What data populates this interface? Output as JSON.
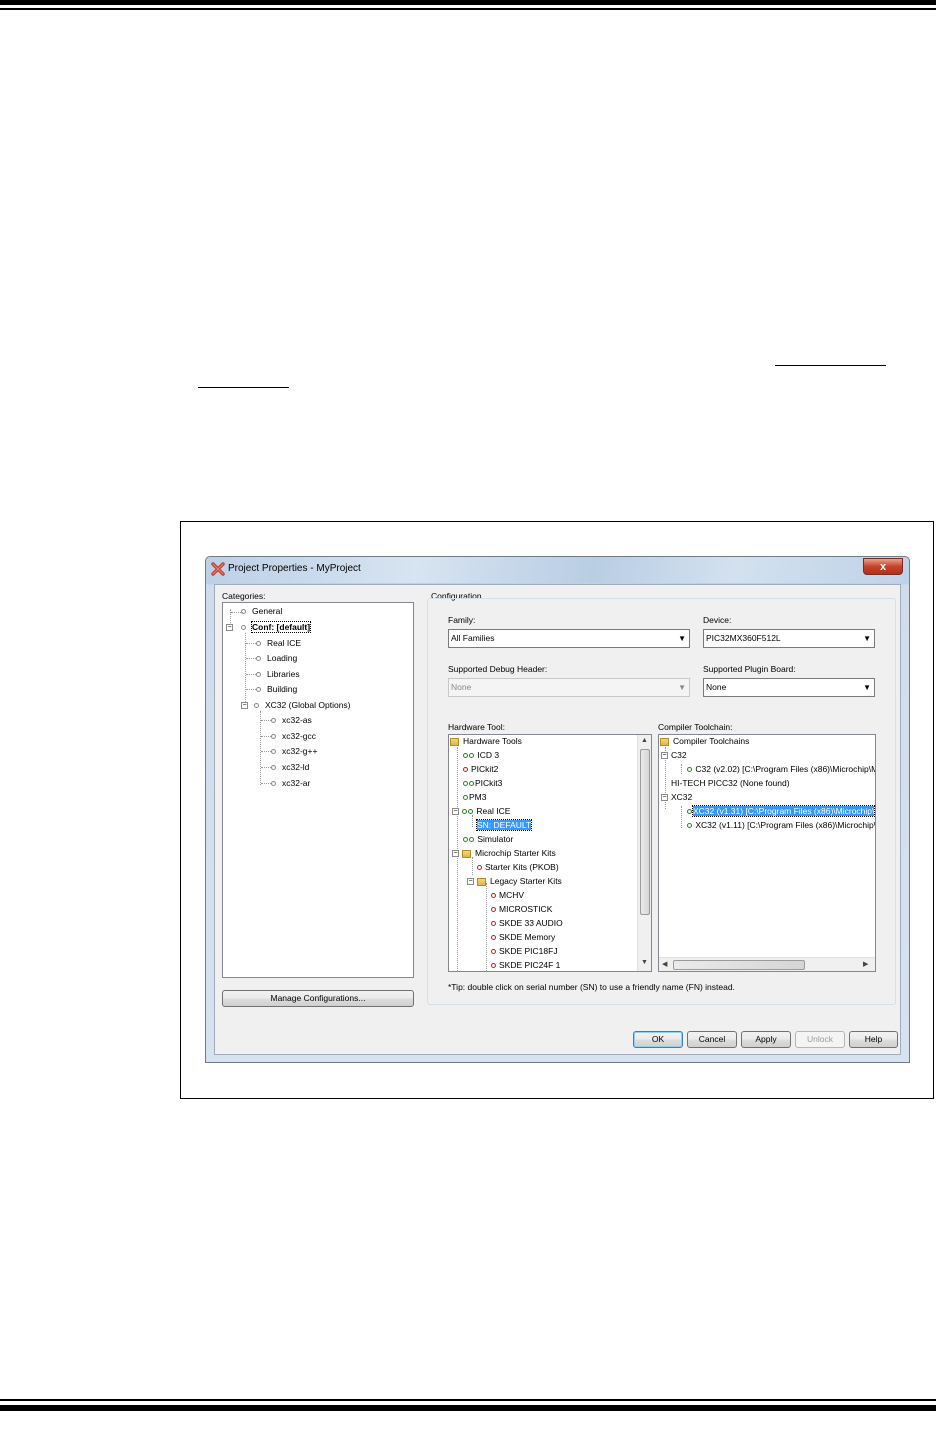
{
  "window": {
    "title": "Project Properties - MyProject",
    "close_label": "x"
  },
  "categories": {
    "label": "Categories:",
    "items": [
      {
        "label": "General"
      },
      {
        "label": "Conf: [default]"
      },
      {
        "label": "Real ICE"
      },
      {
        "label": "Loading"
      },
      {
        "label": "Libraries"
      },
      {
        "label": "Building"
      },
      {
        "label": "XC32 (Global Options)"
      },
      {
        "label": "xc32-as"
      },
      {
        "label": "xc32-gcc"
      },
      {
        "label": "xc32-g++"
      },
      {
        "label": "xc32-ld"
      },
      {
        "label": "xc32-ar"
      }
    ],
    "manage_button": "Manage Configurations..."
  },
  "configuration": {
    "group_label": "Configuration",
    "family": {
      "label": "Family:",
      "value": "All Families"
    },
    "device": {
      "label": "Device:",
      "value": "PIC32MX360F512L"
    },
    "debug_header": {
      "label": "Supported Debug Header:",
      "value": "None"
    },
    "plugin_board": {
      "label": "Supported Plugin Board:",
      "value": "None"
    },
    "hardware_tool": {
      "label": "Hardware Tool:",
      "items": [
        {
          "label": "Hardware Tools"
        },
        {
          "label": "ICD 3"
        },
        {
          "label": "PICkit2"
        },
        {
          "label": "PICkit3"
        },
        {
          "label": "PM3"
        },
        {
          "label": "Real ICE"
        },
        {
          "label": "SN: DEFAULT"
        },
        {
          "label": "Simulator"
        },
        {
          "label": "Microchip Starter Kits"
        },
        {
          "label": "Starter Kits (PKOB)"
        },
        {
          "label": "Legacy Starter Kits"
        },
        {
          "label": "MCHV"
        },
        {
          "label": "MICROSTICK"
        },
        {
          "label": "SKDE 33 AUDIO"
        },
        {
          "label": "SKDE Memory"
        },
        {
          "label": "SKDE PIC18FJ"
        },
        {
          "label": "SKDE PIC24F 1"
        }
      ]
    },
    "compiler_toolchain": {
      "label": "Compiler Toolchain:",
      "items": [
        {
          "label": "Compiler Toolchains"
        },
        {
          "label": "C32"
        },
        {
          "label": "C32 (v2.02) [C:\\Program Files (x86)\\Microchip\\M"
        },
        {
          "label": "HI-TECH PICC32 (None found)"
        },
        {
          "label": "XC32"
        },
        {
          "label": "XC32 (v1.31) [C:\\Program Files (x86)\\Microchip\\"
        },
        {
          "label": "XC32 (v1.11) [C:\\Program Files (x86)\\Microchip\\"
        }
      ]
    },
    "tip": "*Tip: double click on serial number (SN) to use a friendly name (FN) instead."
  },
  "buttons": {
    "ok": "OK",
    "cancel": "Cancel",
    "apply": "Apply",
    "unlock": "Unlock",
    "help": "Help"
  },
  "colors": {
    "selection": "#3399ff",
    "close_button": "#c4432b"
  }
}
